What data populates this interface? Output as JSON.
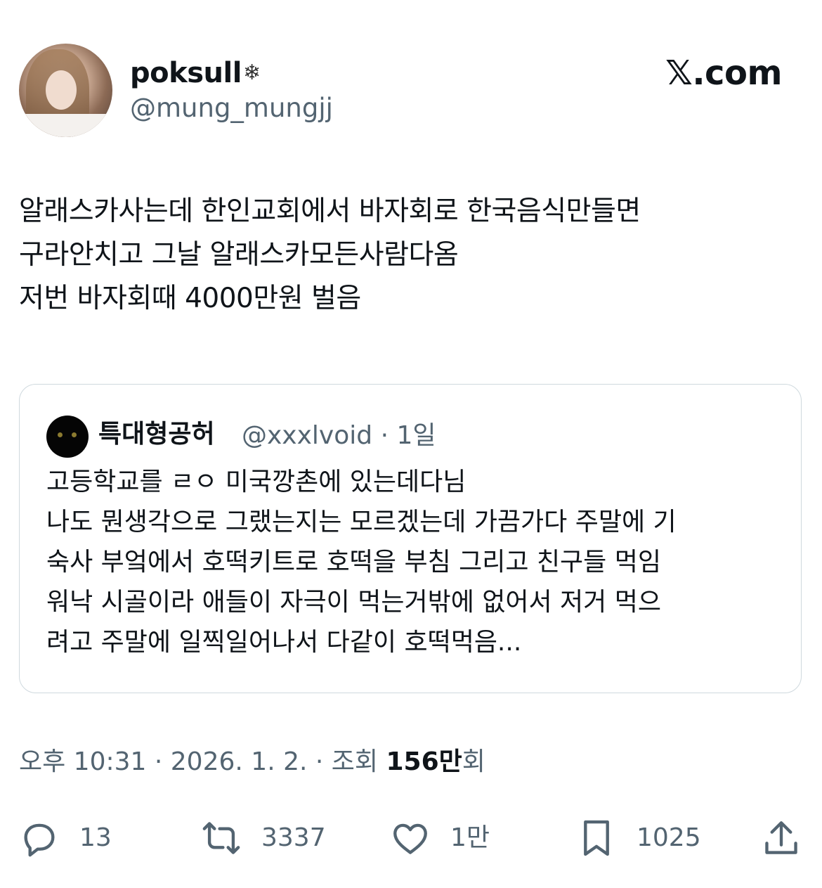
{
  "author": {
    "display_name": "poksull",
    "badge": "❄",
    "handle": "@mung_mungjj",
    "avatar_icon": "profile-photo"
  },
  "brand": "𝕏.com",
  "tweet": {
    "lines": [
      "알래스카사는데 한인교회에서 바자회로 한국음식만들면",
      "구라안치고 그날 알래스카모든사람다옴",
      "저번 바자회때 4000만원 벌음"
    ]
  },
  "quote": {
    "display_name": "특대형공허",
    "handle": "@xxxlvoid",
    "separator": "·",
    "time": "1일",
    "lines": [
      "고등학교를 ㄹㅇ 미국깡촌에 있는데다님",
      "나도 뭔생각으로 그랬는지는 모르겠는데 가끔가다 주말에 기",
      "숙사 부엌에서 호떡키트로 호떡을 부침 그리고 친구들 먹임",
      "워낙 시골이라 애들이 자극이 먹는거밖에 없어서 저거 먹으",
      "려고 주말에 일찍일어나서 다같이 호떡먹음..."
    ]
  },
  "meta": {
    "time": "오후 10:31",
    "sep1": " · ",
    "date": "2026. 1. 2.",
    "sep2": " · ",
    "views_label": "조회 ",
    "views_count": "156만",
    "views_suffix": "회"
  },
  "actions": {
    "replies": "13",
    "reposts": "3337",
    "likes": "1만",
    "bookmarks": "1025"
  },
  "colors": {
    "text": "#0f1419",
    "secondary": "#536471",
    "border": "#cfd9de"
  }
}
